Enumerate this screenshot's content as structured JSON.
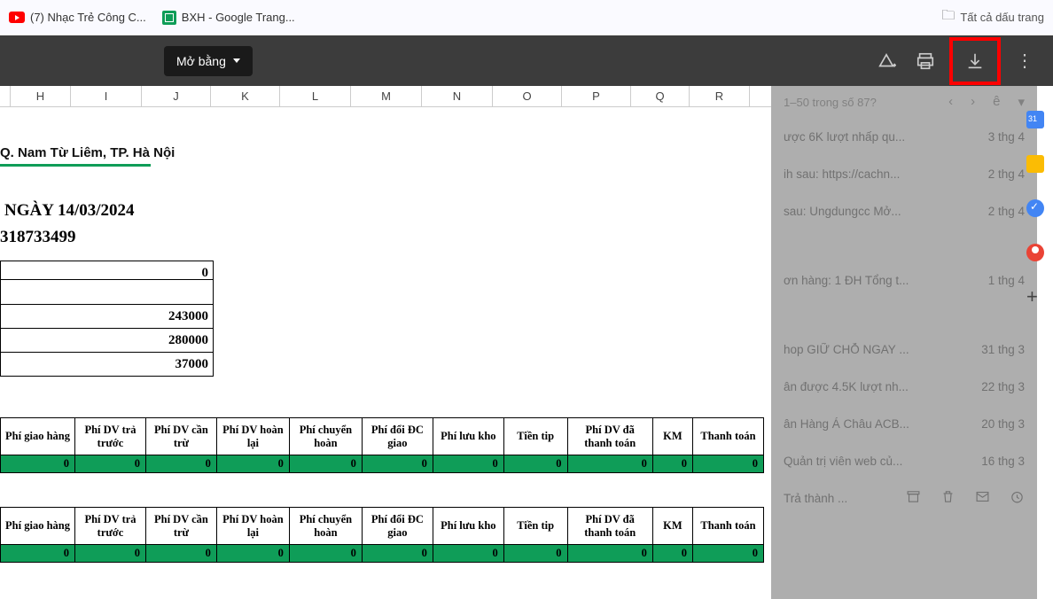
{
  "bookmarks": {
    "items": [
      {
        "label": "(7) Nhạc Trẻ Công C..."
      },
      {
        "label": "BXH - Google Trang..."
      }
    ],
    "all_label": "Tất cả dấu trang"
  },
  "toolbar": {
    "open_with": "Mở bằng"
  },
  "columns": [
    "H",
    "I",
    "J",
    "K",
    "L",
    "M",
    "N",
    "O",
    "P",
    "Q",
    "R"
  ],
  "sheet": {
    "address": "Q. Nam Từ Liêm, TP. Hà Nội",
    "title_date_prefix": " NGÀY ",
    "title_date": "14/03/2024",
    "code": "318733499",
    "stack": [
      "0",
      "",
      "243000",
      "280000",
      "37000"
    ]
  },
  "fee_headers": [
    "Phí giao hàng",
    "Phí DV trả trước",
    "Phí DV cần trừ",
    "Phí DV hoàn lại",
    "Phí chuyển hoàn",
    "Phí đổi ĐC giao",
    "Phí lưu kho",
    "Tiền tip",
    "Phí DV đã thanh toán",
    "KM",
    "Thanh toán"
  ],
  "fee_row": [
    "0",
    "0",
    "0",
    "0",
    "0",
    "0",
    "0",
    "0",
    "0",
    "0",
    "0"
  ],
  "right_panel": {
    "pager": "1–50 trong số 87?",
    "letter": "ê",
    "rows": [
      {
        "text": "ược 6K lượt nhấp qu...",
        "date": "3 thg 4"
      },
      {
        "text": "ih sau: https://cachn...",
        "date": "2 thg 4"
      },
      {
        "text": " sau: Ungdungcc Mở...",
        "date": "2 thg 4"
      },
      {
        "text": "ơn hàng: 1 ĐH Tổng t...",
        "date": "1 thg 4"
      },
      {
        "text": "hop GIỮ CHỖ NGAY ...",
        "date": "31 thg 3"
      },
      {
        "text": "ân được 4.5K lượt nh...",
        "date": "22 thg 3"
      },
      {
        "text": "ân Hàng Á Châu ACB...",
        "date": "20 thg 3"
      },
      {
        "text": "Quản trị viên web củ...",
        "date": "16 thg 3"
      },
      {
        "text": "Trả thành ...",
        "date": ""
      }
    ]
  }
}
